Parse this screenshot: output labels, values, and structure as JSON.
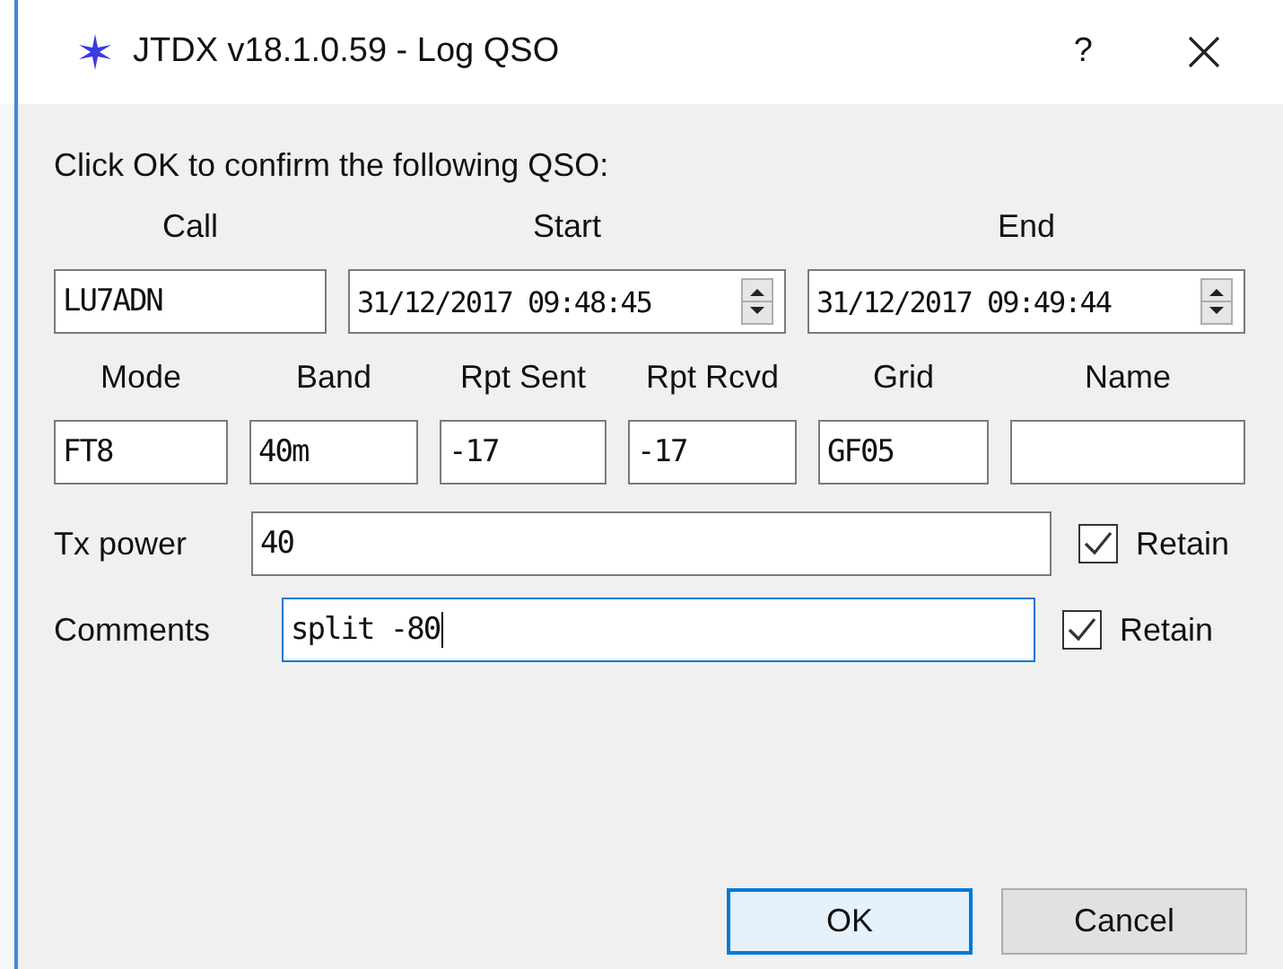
{
  "window": {
    "title": "JTDX v18.1.0.59 - Log QSO",
    "help": "?"
  },
  "prompt": "Click OK to confirm the following QSO:",
  "row1": [
    {
      "kind": "text",
      "label": "Call",
      "value": "LU7ADN"
    },
    {
      "kind": "datetime",
      "label": "Start",
      "value": "31/12/2017 09:48:45"
    },
    {
      "kind": "datetime",
      "label": "End",
      "value": "31/12/2017 09:49:44"
    }
  ],
  "row2": [
    {
      "label": "Mode",
      "value": "FT8"
    },
    {
      "label": "Band",
      "value": "40m"
    },
    {
      "label": "Rpt Sent",
      "value": "-17"
    },
    {
      "label": "Rpt Rcvd",
      "value": "-17"
    },
    {
      "label": "Grid",
      "value": "GF05"
    },
    {
      "label": "Name"
    }
  ],
  "lines": [
    {
      "label": "Tx power",
      "value": "40",
      "focused": false,
      "retain": {
        "label": "Retain",
        "checked": true
      }
    },
    {
      "label": "Comments",
      "value": "split -80",
      "focused": true,
      "retain": {
        "label": "Retain",
        "checked": true
      }
    }
  ],
  "buttons": [
    {
      "label": "OK",
      "default": true
    },
    {
      "label": "Cancel",
      "default": false
    }
  ]
}
